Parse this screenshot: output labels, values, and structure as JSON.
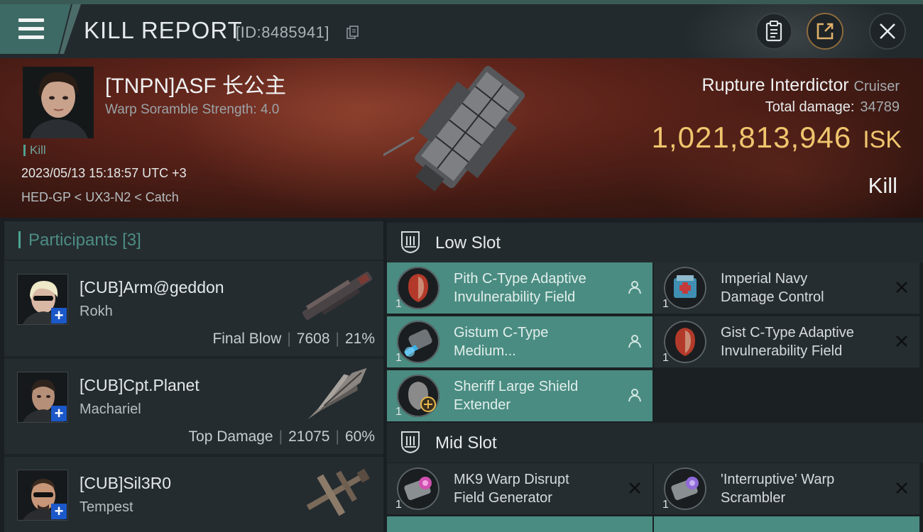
{
  "header": {
    "title": "KILL REPORT",
    "id_text": "[ID:8485941]"
  },
  "victim": {
    "name": "[TNPN]ASF 长公主",
    "subtitle": "Warp Soramble Strength: 4.0",
    "tag": "Kill",
    "datetime": "2023/05/13 15:18:57 UTC +3",
    "location": "HED-GP < UX3-N2 < Catch",
    "ship_name": "Rupture Interdictor",
    "ship_class": "Cruiser",
    "total_damage_label": "Total damage:",
    "total_damage": "34789",
    "isk_value": "1,021,813,946",
    "isk_unit": "ISK",
    "result": "Kill"
  },
  "participants": {
    "title": "Participants",
    "count": "[3]",
    "list": [
      {
        "name": "[CUB]Arm@geddon",
        "ship": "Rokh",
        "role": "Final Blow",
        "damage": "7608",
        "percent": "21%"
      },
      {
        "name": "[CUB]Cpt.Planet",
        "ship": "Machariel",
        "role": "Top Damage",
        "damage": "21075",
        "percent": "60%"
      },
      {
        "name": "[CUB]Sil3R0",
        "ship": "Tempest"
      }
    ]
  },
  "low_slot": {
    "label": "Low Slot",
    "items": [
      {
        "line1": "Pith C-Type Adaptive",
        "line2": "Invulnerability Field",
        "qty": "1",
        "status": "dropped",
        "color": "#b33a2a"
      },
      {
        "line1": "Imperial Navy",
        "line2": "Damage Control",
        "qty": "1",
        "status": "destroyed",
        "color": "#3f8fb3"
      },
      {
        "line1": "Gistum C-Type",
        "line2": "Medium...",
        "qty": "1",
        "status": "dropped",
        "color": "#3ab0e6"
      },
      {
        "line1": "Gist C-Type Adaptive",
        "line2": "Invulnerability Field",
        "qty": "1",
        "status": "destroyed",
        "color": "#b33a2a"
      },
      {
        "line1": "Sheriff Large Shield",
        "line2": "Extender",
        "qty": "1",
        "status": "dropped",
        "color": "#8a8a8a"
      }
    ]
  },
  "mid_slot": {
    "label": "Mid Slot",
    "items": [
      {
        "line1": "MK9 Warp Disrupt",
        "line2": "Field Generator",
        "qty": "1",
        "status": "destroyed",
        "color": "#d050b0"
      },
      {
        "line1": "'Interruptive' Warp",
        "line2": "Scrambler",
        "qty": "1",
        "status": "destroyed",
        "color": "#8f6ad8"
      }
    ]
  },
  "colors": {
    "accent_teal": "#4a8c81",
    "isk_gold": "#f0c56e",
    "badge_blue": "#1b58c9"
  },
  "icons": [
    "menu-icon",
    "copy-icon",
    "clipboard-icon",
    "share-icon",
    "close-icon",
    "person-icon",
    "x-icon",
    "slot-icon"
  ]
}
